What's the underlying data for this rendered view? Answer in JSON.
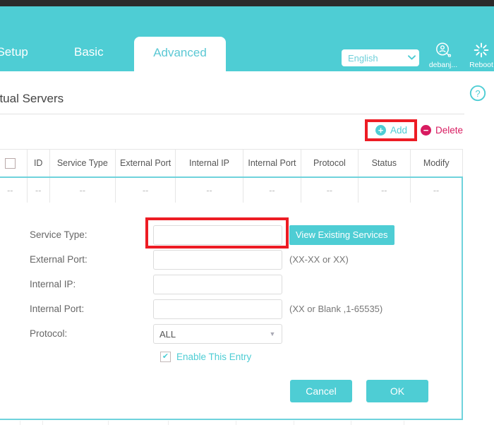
{
  "header": {
    "nav": [
      {
        "label": "t Setup",
        "active": false
      },
      {
        "label": "Basic",
        "active": false
      },
      {
        "label": "Advanced",
        "active": true
      }
    ],
    "language": {
      "selected": "English",
      "chevron": "⌄"
    },
    "account": {
      "label": "debanj...",
      "icon": "account-icon"
    },
    "reboot": {
      "label": "Reboot",
      "icon": "reboot-icon"
    }
  },
  "page": {
    "title": "irtual Servers",
    "help_icon": "help-icon"
  },
  "actions": {
    "add": {
      "label": "Add",
      "glyph": "+",
      "color": "#4ECDD4"
    },
    "delete": {
      "label": "Delete",
      "glyph": "−",
      "color": "#D81B60"
    }
  },
  "table": {
    "columns": [
      "",
      "ID",
      "Service Type",
      "External Port",
      "Internal IP",
      "Internal Port",
      "Protocol",
      "Status",
      "Modify"
    ],
    "rows": [
      [
        "--",
        "--",
        "--",
        "--",
        "--",
        "--",
        "--",
        "--",
        "--"
      ]
    ]
  },
  "form": {
    "service_type": {
      "label": "Service Type:",
      "value": "",
      "placeholder": ""
    },
    "view_existing": {
      "label": "View Existing Services"
    },
    "external_port": {
      "label": "External Port:",
      "value": "",
      "hint": "(XX-XX or XX)"
    },
    "internal_ip": {
      "label": "Internal IP:",
      "value": "",
      "hint": ""
    },
    "internal_port": {
      "label": "Internal Port:",
      "value": "",
      "hint": "(XX or Blank ,1-65535)"
    },
    "protocol": {
      "label": "Protocol:",
      "selected": "ALL",
      "arrow": "▼"
    },
    "enable": {
      "label": "Enable This Entry",
      "checked": true,
      "check_glyph": "✔"
    },
    "cancel": {
      "label": "Cancel"
    },
    "ok": {
      "label": "OK"
    }
  }
}
